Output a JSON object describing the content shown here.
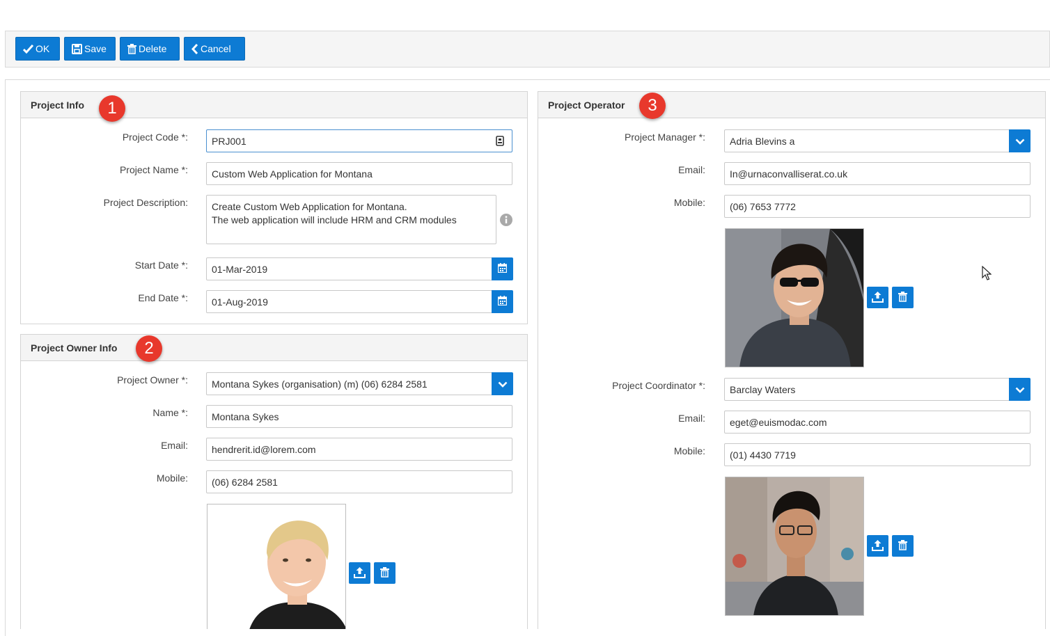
{
  "toolbar": {
    "ok": "OK",
    "save": "Save",
    "delete": "Delete",
    "cancel": "Cancel"
  },
  "project_info": {
    "title": "Project Info",
    "badge": "1",
    "code_label": "Project Code *:",
    "code_value": "PRJ001",
    "name_label": "Project Name *:",
    "name_value": "Custom Web Application for Montana",
    "desc_label": "Project Description:",
    "desc_line1": "Create Custom Web Application for Montana.",
    "desc_line2": "The web application will include HRM and CRM modules",
    "start_label": "Start Date *:",
    "start_value": "01-Mar-2019",
    "end_label": "End Date *:",
    "end_value": "01-Aug-2019"
  },
  "owner_info": {
    "title": "Project Owner Info",
    "badge": "2",
    "owner_label": "Project Owner *:",
    "owner_value": "Montana Sykes (organisation) (m) (06) 6284 2581",
    "name_label": "Name *:",
    "name_value": "Montana Sykes",
    "email_label": "Email:",
    "email_value": "hendrerit.id@lorem.com",
    "mobile_label": "Mobile:",
    "mobile_value": "(06) 6284 2581"
  },
  "operator": {
    "title": "Project Operator",
    "badge": "3",
    "manager_label": "Project Manager *:",
    "manager_value": "Adria Blevins a",
    "manager_email_label": "Email:",
    "manager_email_value": "In@urnaconvalliserat.co.uk",
    "manager_mobile_label": "Mobile:",
    "manager_mobile_value": "(06) 7653 7772",
    "coord_label": "Project Coordinator *:",
    "coord_value": "Barclay Waters",
    "coord_email_label": "Email:",
    "coord_email_value": "eget@euismodac.com",
    "coord_mobile_label": "Mobile:",
    "coord_mobile_value": "(01) 4430 7719"
  },
  "colors": {
    "primary": "#0d7bd4",
    "badge": "#e8382c",
    "panel_header": "#f4f4f4"
  }
}
